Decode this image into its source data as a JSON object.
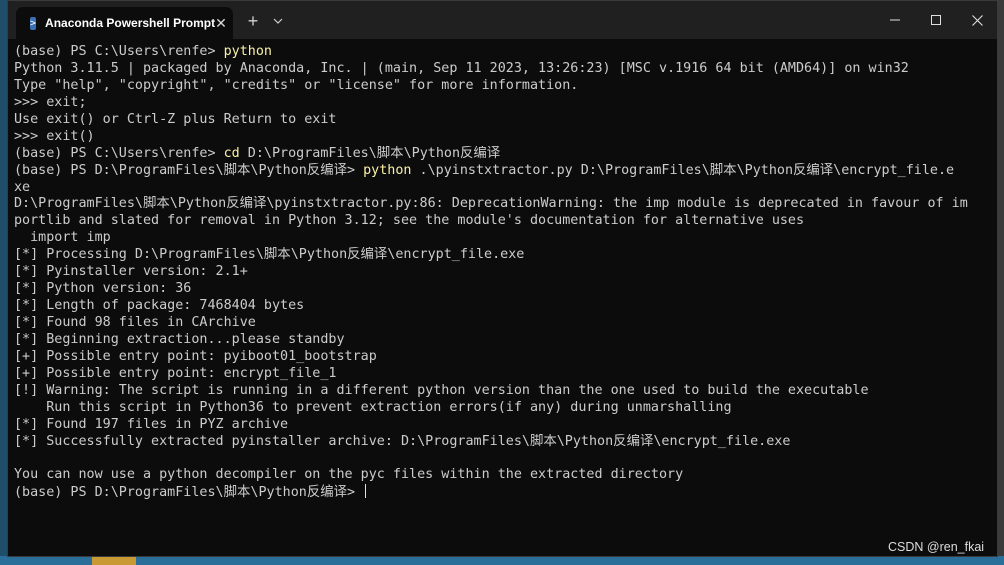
{
  "window": {
    "tab_title": "Anaconda Powershell Prompt",
    "tab_icon": "powershell-icon",
    "new_tab_glyph": "+",
    "close_tab_glyph": "✕"
  },
  "colors": {
    "console_bg": "#0c0c0c",
    "console_text": "#cccccc",
    "command_text": "#f9f1a5",
    "titlebar_bg": "#202020"
  },
  "console": {
    "lines": [
      {
        "a": "(base) PS C:\\Users\\renfe> ",
        "b": "python",
        "c": ""
      },
      {
        "a": "Python 3.11.5 | packaged by Anaconda, Inc. | (main, Sep 11 2023, 13:26:23) [MSC v.1916 64 bit (AMD64)] on win32",
        "b": "",
        "c": ""
      },
      {
        "a": "Type \"help\", \"copyright\", \"credits\" or \"license\" for more information.",
        "b": "",
        "c": ""
      },
      {
        "a": ">>> exit;",
        "b": "",
        "c": ""
      },
      {
        "a": "Use exit() or Ctrl-Z plus Return to exit",
        "b": "",
        "c": ""
      },
      {
        "a": ">>> exit()",
        "b": "",
        "c": ""
      },
      {
        "a": "(base) PS C:\\Users\\renfe> ",
        "b": "cd",
        "c": " D:\\ProgramFiles\\脚本\\Python反编译"
      },
      {
        "a": "(base) PS D:\\ProgramFiles\\脚本\\Python反编译> ",
        "b": "python",
        "c": " .\\pyinstxtractor.py D:\\ProgramFiles\\脚本\\Python反编译\\encrypt_file.e"
      },
      {
        "a": "xe",
        "b": "",
        "c": ""
      },
      {
        "a": "D:\\ProgramFiles\\脚本\\Python反编译\\pyinstxtractor.py:86: DeprecationWarning: the imp module is deprecated in favour of im",
        "b": "",
        "c": ""
      },
      {
        "a": "portlib and slated for removal in Python 3.12; see the module's documentation for alternative uses",
        "b": "",
        "c": ""
      },
      {
        "a": "  import imp",
        "b": "",
        "c": ""
      },
      {
        "a": "[*] Processing D:\\ProgramFiles\\脚本\\Python反编译\\encrypt_file.exe",
        "b": "",
        "c": ""
      },
      {
        "a": "[*] Pyinstaller version: 2.1+",
        "b": "",
        "c": ""
      },
      {
        "a": "[*] Python version: 36",
        "b": "",
        "c": ""
      },
      {
        "a": "[*] Length of package: 7468404 bytes",
        "b": "",
        "c": ""
      },
      {
        "a": "[*] Found 98 files in CArchive",
        "b": "",
        "c": ""
      },
      {
        "a": "[*] Beginning extraction...please standby",
        "b": "",
        "c": ""
      },
      {
        "a": "[+] Possible entry point: pyiboot01_bootstrap",
        "b": "",
        "c": ""
      },
      {
        "a": "[+] Possible entry point: encrypt_file_1",
        "b": "",
        "c": ""
      },
      {
        "a": "[!] Warning: The script is running in a different python version than the one used to build the executable",
        "b": "",
        "c": ""
      },
      {
        "a": "    Run this script in Python36 to prevent extraction errors(if any) during unmarshalling",
        "b": "",
        "c": ""
      },
      {
        "a": "[*] Found 197 files in PYZ archive",
        "b": "",
        "c": ""
      },
      {
        "a": "[*] Successfully extracted pyinstaller archive: D:\\ProgramFiles\\脚本\\Python反编译\\encrypt_file.exe",
        "b": "",
        "c": ""
      },
      {
        "a": "",
        "b": "",
        "c": ""
      },
      {
        "a": "You can now use a python decompiler on the pyc files within the extracted directory",
        "b": "",
        "c": ""
      },
      {
        "a": "(base) PS D:\\ProgramFiles\\脚本\\Python反编译> ",
        "b": "",
        "c": ""
      }
    ]
  },
  "watermark": "CSDN @ren_fkai"
}
